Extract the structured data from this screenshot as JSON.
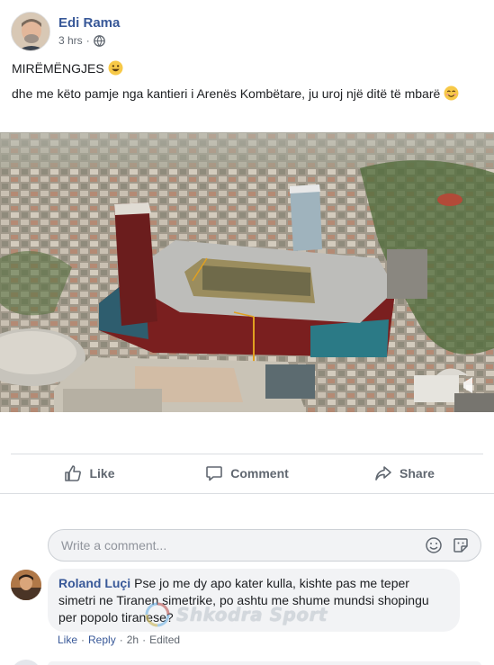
{
  "post": {
    "author": "Edi Rama",
    "timestamp": "3 hrs",
    "separator": "·",
    "privacy_icon": "globe-icon",
    "line1": "MIRËMËNGJES",
    "line2": "dhe me këto pamje nga kantieri i Arenës Kombëtare, ju uroj një ditë të mbarë",
    "image_icon": "stadium-construction-aerial-photo"
  },
  "actions": {
    "like_label": "Like",
    "comment_label": "Comment",
    "share_label": "Share"
  },
  "composer": {
    "placeholder": "Write a comment...",
    "icons": [
      "emoji-icon",
      "sticker-icon"
    ]
  },
  "comments": [
    {
      "author": "Roland Luçi",
      "text": "Pse jo me dy apo kater kulla, kishte pas me teper simetri ne Tiranen simetrike, po ashtu me shume mundsi shopingu per popolo tiranese?",
      "like_label": "Like",
      "reply_label": "Reply",
      "time": "2h",
      "edited_label": "Edited"
    }
  ],
  "watermark": {
    "text": "Shkodra Sport"
  },
  "colors": {
    "link_blue": "#385898",
    "text": "#1c1e21",
    "secondary": "#606770",
    "bubble_bg": "#f2f3f5",
    "divider": "#dadde1"
  }
}
